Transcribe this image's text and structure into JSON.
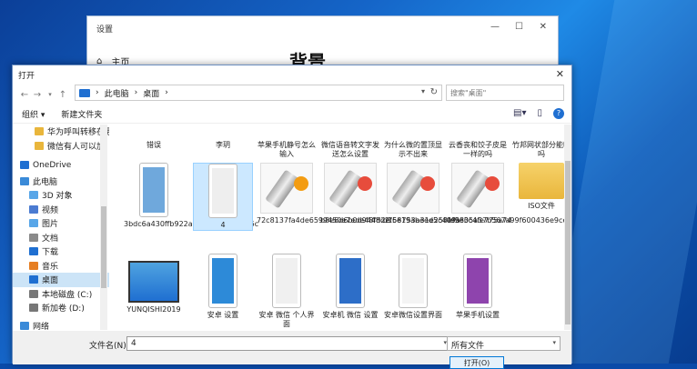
{
  "settings": {
    "title": "设置",
    "home": "主页",
    "heading": "背景"
  },
  "dialog": {
    "title": "打开",
    "breadcrumb": [
      "此电脑",
      "桌面"
    ],
    "search_placeholder": "搜索\"桌面\"",
    "toolbar": {
      "organize": "组织 ▾",
      "new_folder": "新建文件夹"
    },
    "tree": [
      {
        "label": "华为呼叫转移在哪",
        "icon": "folder-icon"
      },
      {
        "label": "微信有人可以加",
        "icon": "folder-icon"
      },
      {
        "label": "OneDrive",
        "icon": "cloud-icon"
      },
      {
        "label": "此电脑",
        "icon": "computer-icon"
      },
      {
        "label": "3D 对象",
        "icon": "cube-icon"
      },
      {
        "label": "视频",
        "icon": "video-icon"
      },
      {
        "label": "图片",
        "icon": "picture-icon"
      },
      {
        "label": "文档",
        "icon": "document-icon"
      },
      {
        "label": "下载",
        "icon": "download-icon"
      },
      {
        "label": "音乐",
        "icon": "music-icon"
      },
      {
        "label": "桌面",
        "icon": "desktop-icon",
        "selected": true
      },
      {
        "label": "本地磁盘 (C:)",
        "icon": "drive-icon"
      },
      {
        "label": "新加卷 (D:)",
        "icon": "drive-icon"
      },
      {
        "label": "网络",
        "icon": "network-icon"
      }
    ],
    "files_row1": [
      "错误",
      "李玥",
      "苹果手机静号怎么输入",
      "微信语音转文字发送怎么设置",
      "为什么微的置顶显示不出来",
      "云香丧和饺子皮是一样的吗",
      "竹邦网状部分能吃吗"
    ],
    "files_row2": [
      "3bdc6a430ffb922acf17b2e6e19b46c",
      "4",
      "72c8137fa4de6599450e7ede48fd2e",
      "b8e6d6b0d9448d2f6e19abeed5c409a",
      "d158753a31e258ef9e3c4fe775a74",
      "fe5805a37b567a99f600436e9cedb0",
      "ISO文件"
    ],
    "files_row3": [
      "YUNQISHI2019",
      "安卓 设置",
      "安卓 微信 个人界面",
      "安卓机 微信 设置",
      "安卓微信设置界面",
      "苹果手机设置"
    ],
    "filename_label": "文件名(N):",
    "filename_value": "4",
    "filetype": "所有文件",
    "open_button": "打开(O)"
  },
  "colors": {
    "accent": "#0078d7",
    "selection": "#cce8ff"
  }
}
